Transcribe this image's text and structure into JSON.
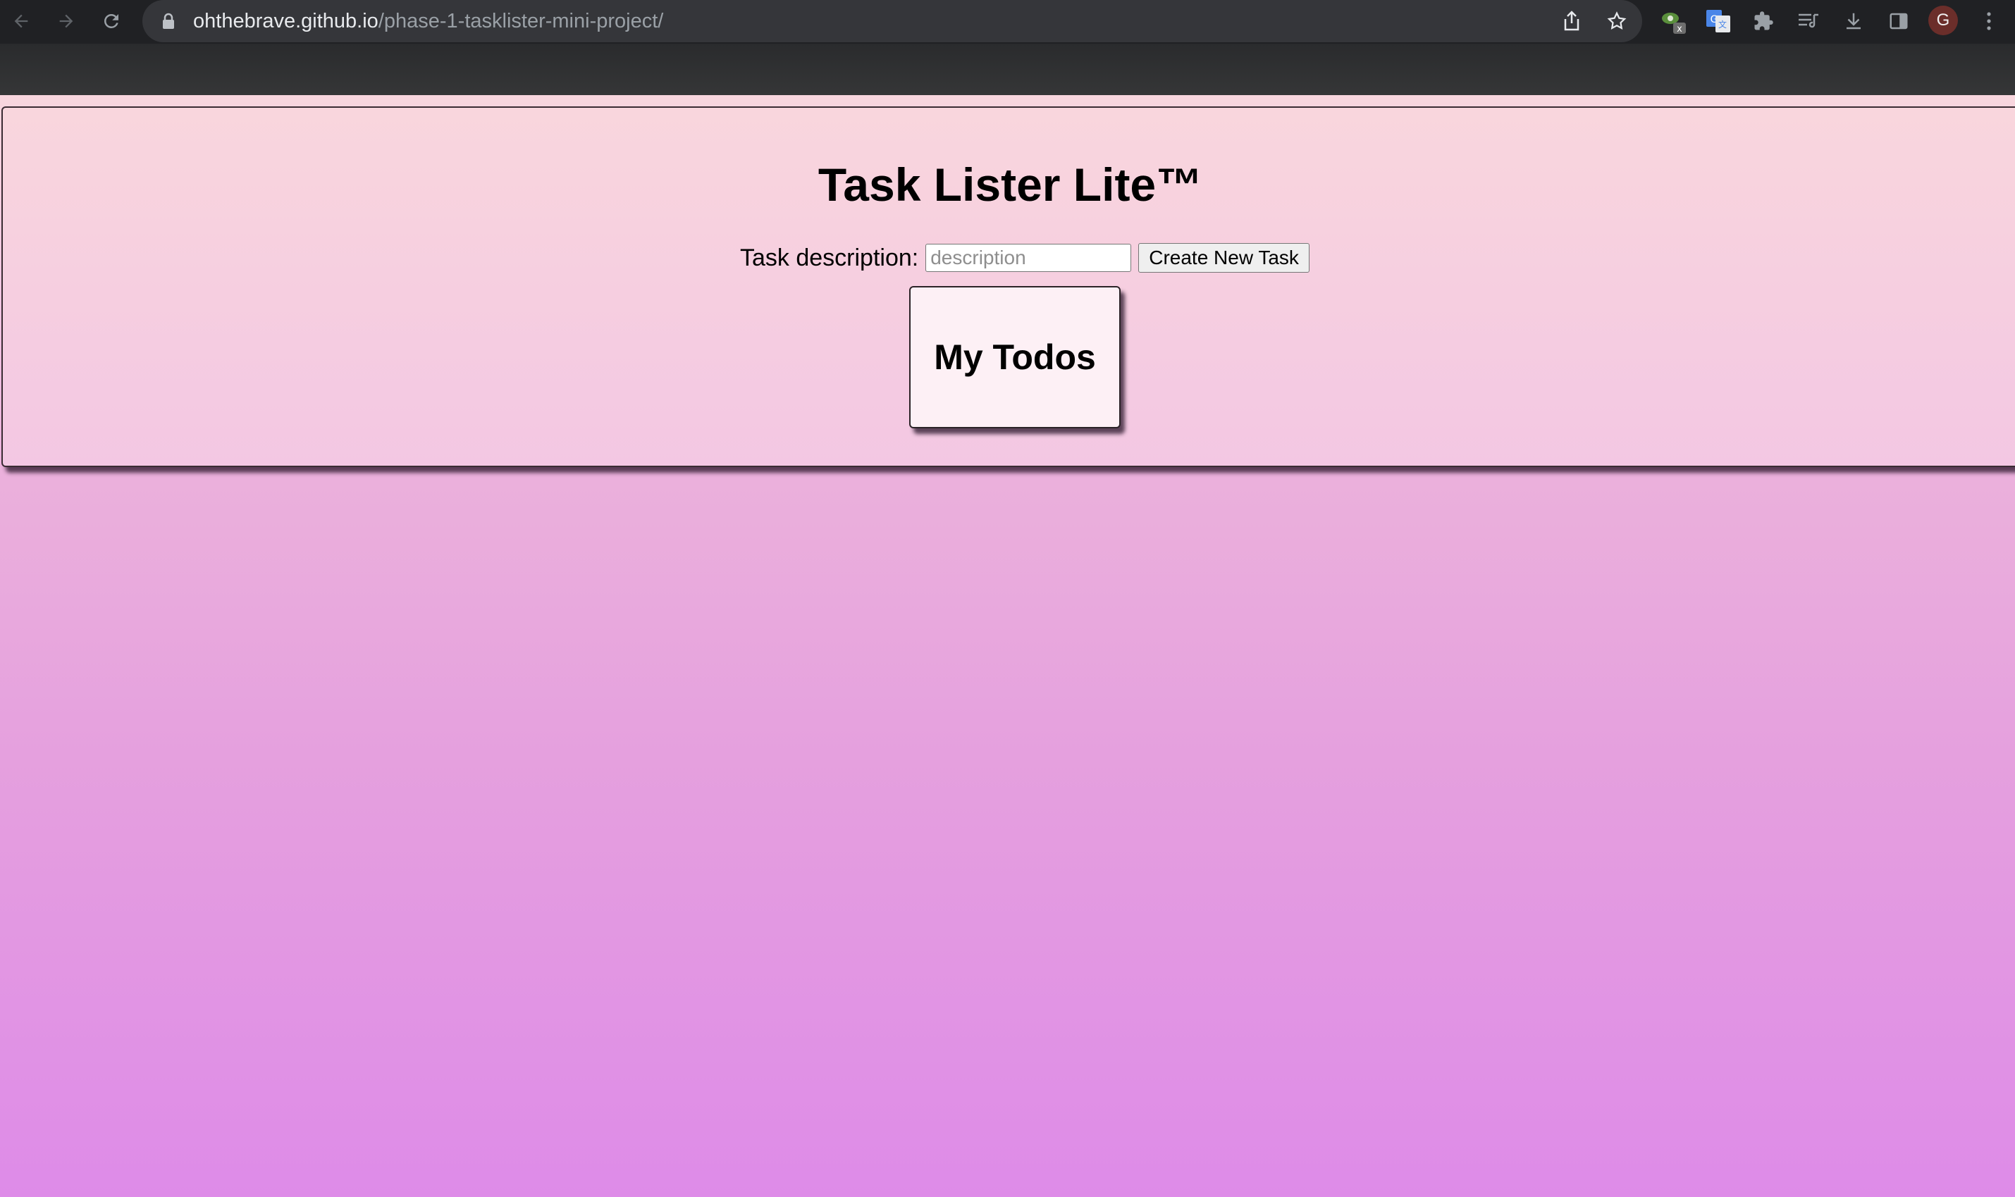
{
  "browser": {
    "url_host": "ohthebrave.github.io",
    "url_path": "/phase-1-tasklister-mini-project/",
    "avatar_letter": "G",
    "icons": {
      "back": "back-arrow-icon",
      "forward": "forward-arrow-icon",
      "reload": "reload-icon",
      "lock": "lock-icon",
      "share": "share-icon",
      "bookmark": "star-icon",
      "extensions": [
        "eye-extension-icon",
        "google-translate-icon",
        "puzzle-extensions-icon",
        "reading-list-icon",
        "download-icon",
        "side-panel-icon"
      ],
      "menu": "kebab-menu-icon"
    }
  },
  "page": {
    "title": "Task Lister Lite™",
    "form": {
      "label": "Task description:",
      "input_placeholder": "description",
      "input_value": "",
      "submit_label": "Create New Task"
    },
    "todos": {
      "heading": "My Todos"
    },
    "colors": {
      "background_top": "#f8d6de",
      "background_bottom": "#de8be8",
      "panel_border": "#3a2b33"
    }
  }
}
